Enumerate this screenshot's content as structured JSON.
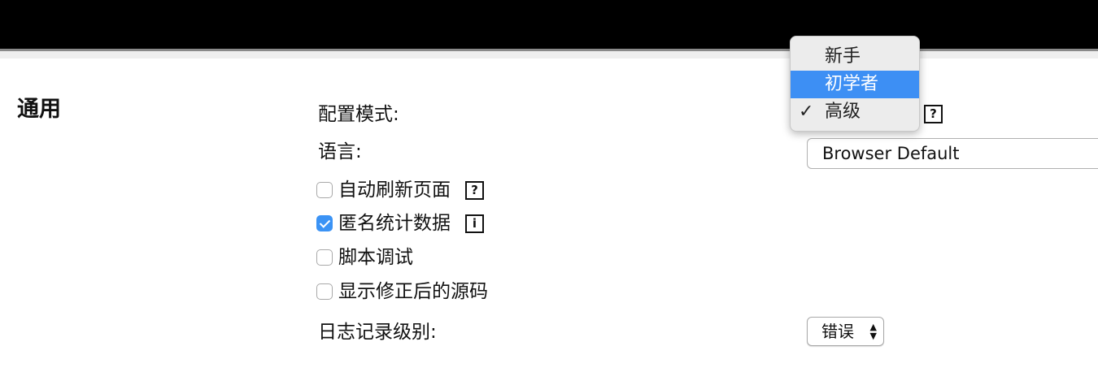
{
  "section": {
    "title": "通用"
  },
  "settings": {
    "config_mode_label": "配置模式:",
    "language_label": "语言:",
    "language_value": "Browser Default",
    "auto_refresh_label": "自动刷新页面",
    "anonymous_stats_label": "匿名统计数据",
    "script_debug_label": "脚本调试",
    "show_fixed_source_label": "显示修正后的源码",
    "log_level_label": "日志记录级别:",
    "log_level_value": "错误"
  },
  "checkboxes": {
    "auto_refresh": false,
    "anonymous_stats": true,
    "script_debug": false,
    "show_fixed_source": false
  },
  "icons": {
    "help": "?",
    "info": "i",
    "checkmark": "✓",
    "select_arrows_up": "▲",
    "select_arrows_down": "▼"
  },
  "config_mode_dropdown": {
    "options": [
      "新手",
      "初学者",
      "高级"
    ],
    "highlighted": "初学者",
    "selected": "高级"
  },
  "colors": {
    "highlight": "#3d8ff4",
    "checkbox_checked": "#3b93f5",
    "top_bar": "#000000"
  }
}
